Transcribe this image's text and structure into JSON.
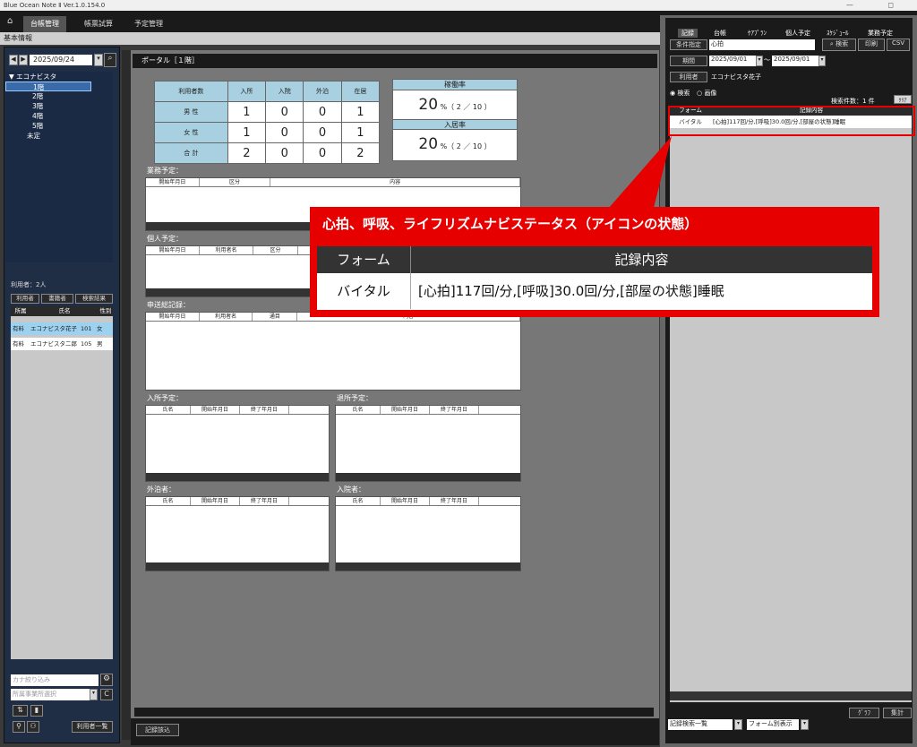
{
  "app": {
    "title": "Blue Ocean Note Ⅱ Ver.1.0.154.0",
    "window_controls": "— ◻"
  },
  "menu": {
    "tabs": [
      "台帳管理",
      "帳票試算",
      "予定管理"
    ],
    "sub": "基本情報"
  },
  "left": {
    "date": "2025/09/24",
    "tree_root": "エコナビスタ",
    "tree_items": [
      "1階",
      "2階",
      "3階",
      "4階",
      "5階",
      "未定"
    ],
    "user_count": "利用者：2人",
    "user_tabs": [
      "利用者",
      "書籍者",
      "検索結果"
    ],
    "user_headers": [
      "所属",
      "氏名",
      "性別"
    ],
    "users": [
      {
        "dept": "有料",
        "name": "エコナビスタ花子",
        "room": "101",
        "sex": "女"
      },
      {
        "dept": "有料",
        "name": "エコナビスタ二郎",
        "room": "105",
        "sex": "男"
      }
    ],
    "search_placeholder": "カナ絞り込み",
    "dept_select": "所属事業所選択",
    "list_button": "利用者一覧"
  },
  "center": {
    "title": "ポータル［１階］",
    "stats": {
      "headers": [
        "利用者数",
        "入所",
        "入院",
        "外泊",
        "在居"
      ],
      "rows": [
        {
          "label": "男 性",
          "v": [
            "1",
            "0",
            "0",
            "1"
          ]
        },
        {
          "label": "女 性",
          "v": [
            "1",
            "0",
            "0",
            "1"
          ]
        },
        {
          "label": "合 計",
          "v": [
            "2",
            "0",
            "0",
            "2"
          ]
        }
      ]
    },
    "rates": [
      {
        "label": "稼働率",
        "value": "20",
        "detail": "%（ 2 ／ 10 ）"
      },
      {
        "label": "入居率",
        "value": "20",
        "detail": "%（ 2 ／ 10 ）"
      }
    ],
    "business": {
      "title": "業務予定：",
      "cols": [
        "開始年月日",
        "区分",
        "内容"
      ]
    },
    "personal": {
      "title": "個人予定：",
      "cols": [
        "開始年月日",
        "利用者名",
        "区分"
      ]
    },
    "handover": {
      "title": "申送総記録：",
      "cols": [
        "開始年月日",
        "利用者名",
        "通目",
        "内容"
      ]
    },
    "admit": {
      "title": "入所予定：",
      "cols": [
        "氏名",
        "開始年月日",
        "終了年月日"
      ]
    },
    "discharge": {
      "title": "退所予定：",
      "cols": [
        "氏名",
        "開始年月日",
        "終了年月日"
      ]
    },
    "stayout": {
      "title": "外泊者：",
      "cols": [
        "氏名",
        "開始年月日",
        "終了年月日"
      ]
    },
    "hospital": {
      "title": "入院者：",
      "cols": [
        "氏名",
        "開始年月日",
        "終了年月日"
      ]
    },
    "record_button": "記録該込"
  },
  "right": {
    "tabs": [
      "記録",
      "台帳",
      "ｹｱﾌﾟﾗﾝ",
      "個人予定",
      "ｽｹｼﾞｭｰﾙ",
      "業務予定"
    ],
    "cond_label": "条件指定",
    "cond_value": "心拍",
    "search": "検索",
    "print": "印刷",
    "csv": "CSV",
    "period_label": "期間",
    "date_from": "2025/09/01",
    "date_to": "2025/09/01",
    "tilde": "～",
    "user_label": "利用者",
    "user_value": "エコナビスタ花子",
    "radio1": "検索",
    "radio2": "画像",
    "count": "検索件数：1 件",
    "clear": "ｸﾘｱ",
    "cols": [
      "フォーム",
      "記録内容"
    ],
    "row": {
      "form": "バイタル",
      "content": "[心拍]117回/分,[呼吸]30.0回/分,[部屋の状態]睡眠"
    },
    "graph": "ｸﾞﾗﾌ",
    "total": "集計",
    "sel1": "記録検索一覧",
    "sel2": "フォーム別表示"
  },
  "callout": {
    "title": "心拍、呼吸、ライフリズムナビステータス（アイコンの状態）",
    "col1": "フォーム",
    "col2": "記録内容",
    "form": "バイタル",
    "content": "[心拍]117回/分,[呼吸]30.0回/分,[部屋の状態]睡眠"
  }
}
